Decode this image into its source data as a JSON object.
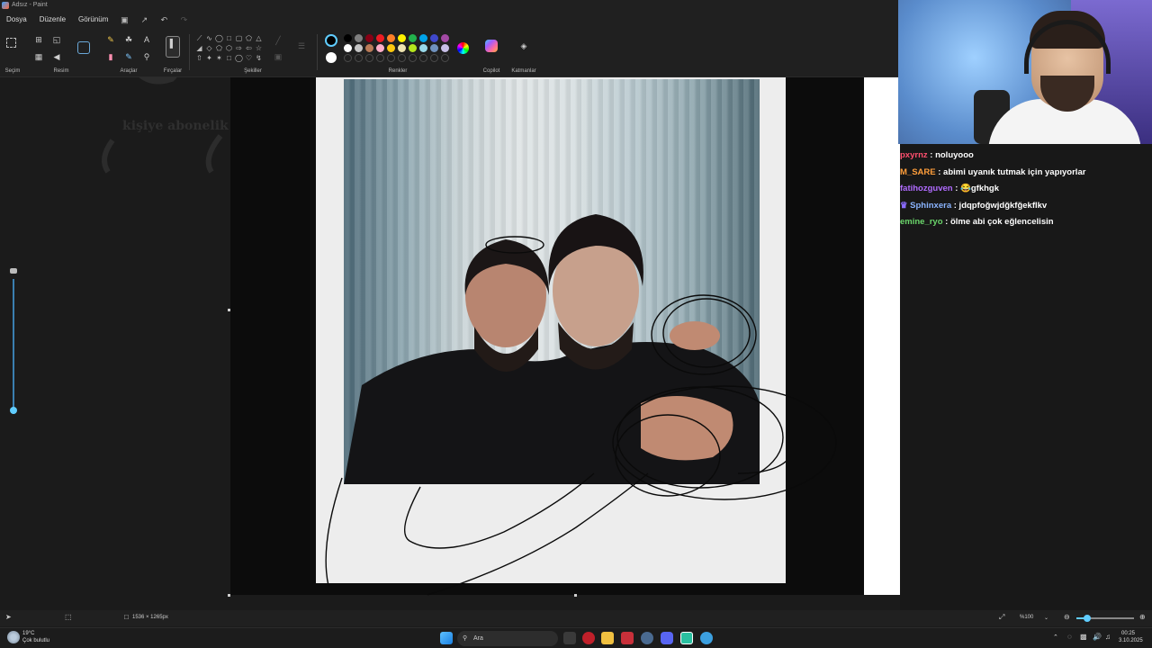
{
  "window": {
    "title": "Adsız - Paint"
  },
  "menu": {
    "items": [
      "Dosya",
      "Düzenle",
      "Görünüm"
    ]
  },
  "ribbon": {
    "groups": {
      "selection": "Seçim",
      "image": "Resim",
      "tools": "Araçlar",
      "brushes": "Fırçalar",
      "shapes": "Şekiller",
      "colors": "Renkler",
      "copilot": "Copilot",
      "layers": "Katmanlar"
    },
    "palette_row1": [
      "#000000",
      "#7f7f7f",
      "#880015",
      "#ed1c24",
      "#ff7f27",
      "#fff200",
      "#22b14c",
      "#00a2e8",
      "#3f48cc",
      "#a349a4"
    ],
    "palette_row2": [
      "#ffffff",
      "#c3c3c3",
      "#b97a57",
      "#ffaec9",
      "#ffc90e",
      "#efe4b0",
      "#b5e61d",
      "#99d9ea",
      "#7092be",
      "#c8bfe7"
    ],
    "active_color": "#000000",
    "secondary_color": "#ffffff"
  },
  "canvas": {
    "overlay_text": "kişiye abonelik hediye etti!"
  },
  "chat": {
    "messages": [
      {
        "user": "pxyrnz",
        "user_color": "#ff4f6e",
        "text": ": noluyooo"
      },
      {
        "user": "M_SARE",
        "user_color": "#ff9e3b",
        "text": ": abimi uyanık tutmak için yapıyorlar"
      },
      {
        "user": "fatihozguven",
        "user_color": "#b06bff",
        "text": ": 😂gfkhgk"
      },
      {
        "user": "Sphinxera",
        "user_color": "#8ab4ff",
        "text": ": jdqpfoğwjdğkfğekflkv"
      },
      {
        "user": "emine_ryo",
        "user_color": "#6bd66b",
        "text": ": ölme abi çok eğlencelisin"
      }
    ]
  },
  "status": {
    "canvas_size": "1536 × 1265px",
    "zoom": "%100"
  },
  "taskbar": {
    "weather_temp": "19°C",
    "weather_desc": "Çok bulutlu",
    "search_placeholder": "Ara",
    "time": "00:25",
    "date": "3.10.2025"
  }
}
